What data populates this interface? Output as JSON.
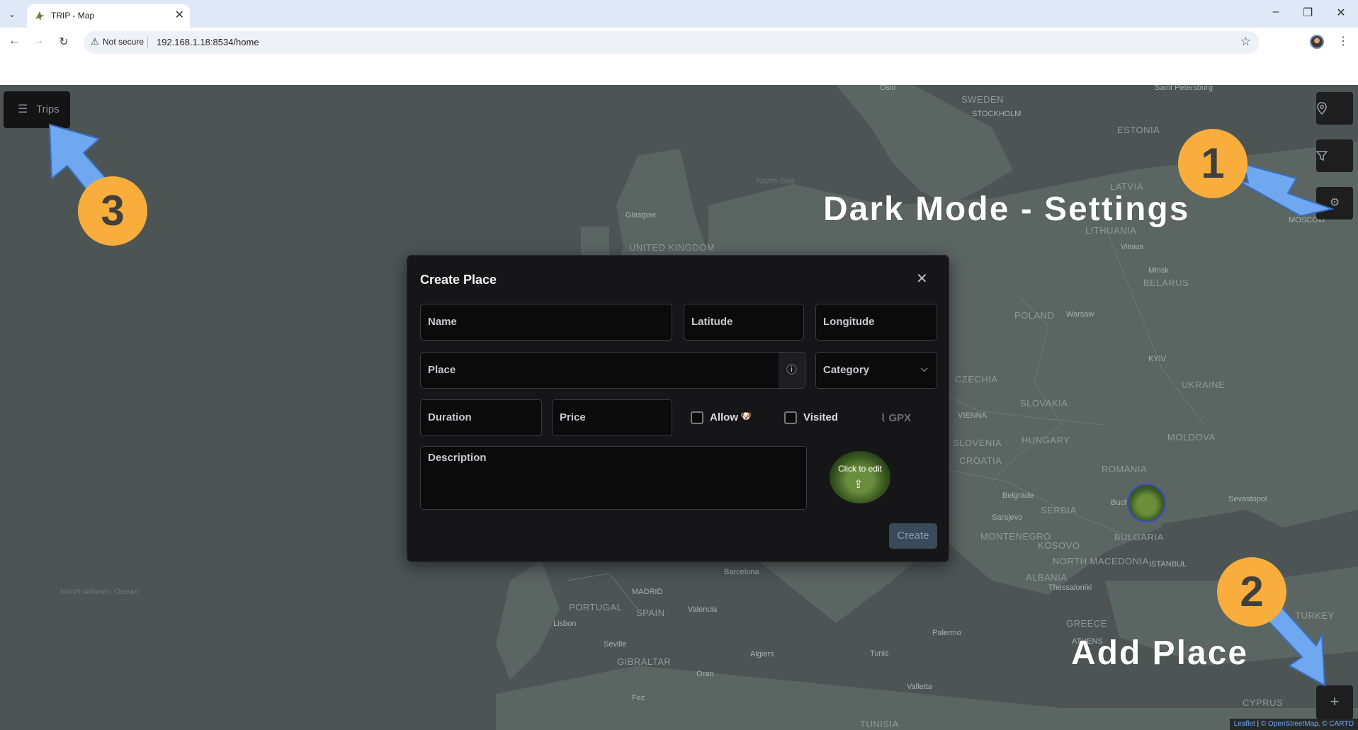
{
  "browser": {
    "tab_title": "TRIP - Map",
    "security_label": "Not secure",
    "url": "192.168.1.18:8534/home"
  },
  "map": {
    "trips_label": "Trips",
    "labels": {
      "countries": [
        "SWEDEN",
        "ESTONIA",
        "LATVIA",
        "LITHUANIA",
        "BELARUS",
        "POLAND",
        "UKRAINE",
        "CZECHIA",
        "SLOVAKIA",
        "HUNGARY",
        "MOLDOVA",
        "ROMANIA",
        "SERBIA",
        "BULGARIA",
        "KOSOVO",
        "NORTH MACEDONIA",
        "ALBANIA",
        "GREECE",
        "TURKEY",
        "CYPRUS",
        "UNITED KINGDOM",
        "PORTUGAL",
        "SPAIN",
        "GIBRALTAR",
        "TUNISIA",
        "MONTENEGRO",
        "CROATIA",
        "SLOVENIA"
      ],
      "cities": [
        "Oslo",
        "STOCKHOLM",
        "Saint Petersburg",
        "Glasgow",
        "Vilnius",
        "Minsk",
        "Warsaw",
        "KYIV",
        "VIENNA",
        "Belgrade",
        "Sarajevo",
        "Sevastopol",
        "Thessaloniki",
        "ISTANBUL",
        "ATHENS",
        "Barcelona",
        "MADRID",
        "Valencia",
        "Lisbon",
        "Seville",
        "Algiers",
        "Tunis",
        "Oran",
        "Valletta",
        "Fez",
        "Palermo",
        "Buch",
        "MOSCOW"
      ],
      "seas": [
        "North Atlantic Ocean",
        "North Sea"
      ]
    },
    "attribution": {
      "leaflet": "Leaflet",
      "separator": "|",
      "copyright": "© OpenStreetMap, © CARTO"
    }
  },
  "modal": {
    "title": "Create Place",
    "fields": {
      "name": "Name",
      "latitude": "Latitude",
      "longitude": "Longitude",
      "place": "Place",
      "category": "Category",
      "duration": "Duration",
      "price": "Price",
      "description": "Description"
    },
    "allow_label": "Allow",
    "visited_label": "Visited",
    "gpx_label": "GPX",
    "image_caption": "Click to edit",
    "create_label": "Create"
  },
  "annotations": {
    "badge1": "1",
    "badge2": "2",
    "badge3": "3",
    "text_settings": "Dark Mode - Settings",
    "text_add_place": "Add Place"
  },
  "colors": {
    "badge": "#f9ad3c",
    "arrow": "#6fa8f0",
    "modal_bg": "#161618",
    "map_bg": "#4c5554"
  }
}
